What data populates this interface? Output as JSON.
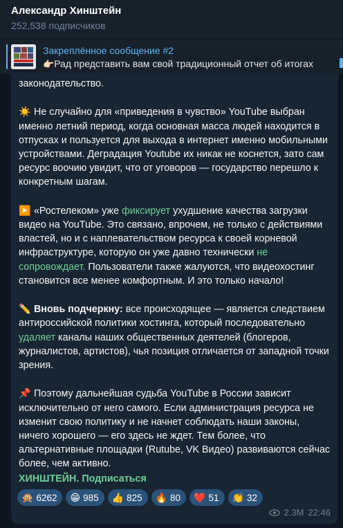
{
  "header": {
    "channel_name": "Александр Хинштейн",
    "subscribers": "252,538 подписчиков"
  },
  "pinned": {
    "title": "Закреплённое сообщение #2",
    "emoji": "👉🏻",
    "text": "Рад представить вам свой традиционный отчет об итогах",
    "thumb_text": "ХИНШТЕЙН"
  },
  "message": {
    "top_line": "законодательство.",
    "p1_emoji": "☀️",
    "p1_text": "Не случайно для «приведения в чувство» YouTube выбран именно летний период, когда основная масса людей находится в отпусках и пользуется для выхода в интернет именно мобильными устройствами. Деградация Youtube их никак не коснется, зато сам ресурс воочию увидит, что от уговоров — государство перешло к конкретным шагам.",
    "p2_emoji": "▶️",
    "p2_a": "«Ростелеком» уже ",
    "p2_link1": "фиксирует",
    "p2_b": " ухудшение качества загрузки видео на YouTube. Это связано, впрочем, не только с действиями властей, но и с наплевательством ресурса к своей корневой инфраструктуре, которую он уже давно технически ",
    "p2_link2": "не сопровождает.",
    "p2_c": "  Пользователи также жалуются, что видеохостинг становится все менее комфортным. И это только начало!",
    "p3_emoji": "✏️",
    "p3_bold": "Вновь подчеркну:",
    "p3_a": " все происходящее — является следствием антироссийской политики хостинга, который последовательно ",
    "p3_link": "удаляет",
    "p3_b": " каналы наших общественных деятелей (блогеров, журналистов, артистов), чья позиция отличается от западной точки зрения.",
    "p4_emoji": "📌",
    "p4_text": "Поэтому дальнейшая судьба YouTube в России зависит исключительно от него самого. Если администрация ресурса не изменит свою политику и не начнет соблюдать наши законы, ничего хорошего — его здесь не ждет. Тем более, что альтернативные площадки (Rutube, VK Видео) развиваются сейчас более, чем активно.",
    "signature": "ХИНШТЕЙН. Подписаться"
  },
  "reactions": [
    {
      "emoji": "🙊",
      "count": "6262"
    },
    {
      "emoji": "😁",
      "count": "985"
    },
    {
      "emoji": "👍",
      "count": "825"
    },
    {
      "emoji": "🔥",
      "count": "80"
    },
    {
      "emoji": "❤️",
      "count": "51"
    },
    {
      "emoji": "👏",
      "count": "32"
    }
  ],
  "meta": {
    "views": "2.3M",
    "time": "22:46"
  },
  "colors": {
    "background": "#0e1621",
    "bubble": "#182533",
    "accent": "#5eb5f7",
    "link": "#6fcf97",
    "reaction_bg": "#2b5278"
  }
}
